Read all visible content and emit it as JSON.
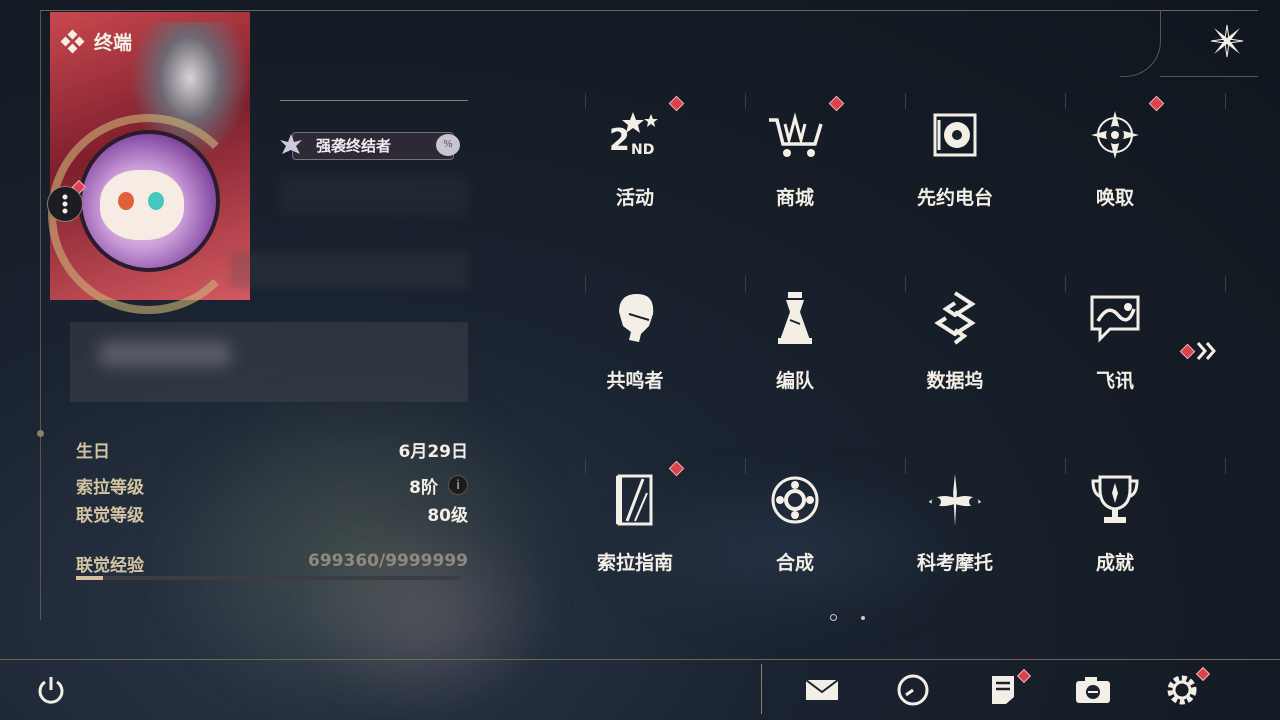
{
  "header": {
    "title": "终端"
  },
  "profile": {
    "title_badge": "强袭终结者",
    "badge_orb": "%"
  },
  "stats": [
    {
      "label": "生日",
      "value": "6月29日"
    },
    {
      "label": "索拉等级",
      "value": "8阶"
    },
    {
      "label": "联觉等级",
      "value": "80级"
    },
    {
      "label": "联觉经验",
      "value": "699360/9999999"
    }
  ],
  "experience": {
    "current": 699360,
    "max": 9999999
  },
  "menu": [
    {
      "label": "活动",
      "icon": "event-2nd-anniversary-icon",
      "badge": true
    },
    {
      "label": "商城",
      "icon": "shop-cart-icon",
      "badge": true
    },
    {
      "label": "先约电台",
      "icon": "radio-station-icon",
      "badge": false
    },
    {
      "label": "唤取",
      "icon": "convene-compass-icon",
      "badge": true
    },
    {
      "label": "共鸣者",
      "icon": "resonator-portrait-icon",
      "badge": false
    },
    {
      "label": "编队",
      "icon": "team-chess-icon",
      "badge": false
    },
    {
      "label": "数据坞",
      "icon": "data-dock-icon",
      "badge": false
    },
    {
      "label": "飞讯",
      "icon": "message-chat-icon",
      "badge": false
    },
    {
      "label": "索拉指南",
      "icon": "guidebook-icon",
      "badge": true
    },
    {
      "label": "合成",
      "icon": "synthesis-icon",
      "badge": false
    },
    {
      "label": "科考摩托",
      "icon": "motorcycle-icon",
      "badge": false
    },
    {
      "label": "成就",
      "icon": "trophy-icon",
      "badge": false
    }
  ],
  "pagination": {
    "current": 1,
    "total": 2
  },
  "bottom_bar": [
    {
      "icon": "power-icon"
    },
    {
      "icon": "mail-icon"
    },
    {
      "icon": "clock-icon"
    },
    {
      "icon": "notes-icon",
      "badge": true
    },
    {
      "icon": "camera-icon"
    },
    {
      "icon": "settings-gear-icon",
      "badge": true
    }
  ],
  "colors": {
    "accent_gold": "#d4c09a",
    "badge_red": "#d9434d",
    "text": "#f3efe6"
  }
}
